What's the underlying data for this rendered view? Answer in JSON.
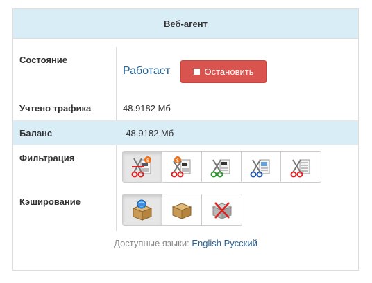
{
  "panel": {
    "title": "Веб-агент"
  },
  "status": {
    "label": "Состояние",
    "value": "Работает",
    "stop_label": "Остановить"
  },
  "traffic": {
    "label": "Учтено трафика",
    "value": "48.9182 Мб"
  },
  "balance": {
    "label": "Баланс",
    "value": "-48.9182 Мб"
  },
  "filtering": {
    "label": "Фильтрация",
    "buttons": [
      {
        "icon": "scissors-dollar-media-icon",
        "active": true
      },
      {
        "icon": "scissors-dollar-video-icon",
        "active": false
      },
      {
        "icon": "scissors-video-list-icon",
        "active": false
      },
      {
        "icon": "scissors-image-list-icon",
        "active": false
      },
      {
        "icon": "scissors-list-icon",
        "active": false
      }
    ]
  },
  "caching": {
    "label": "Кэширование",
    "buttons": [
      {
        "icon": "box-globe-icon",
        "active": true
      },
      {
        "icon": "box-icon",
        "active": false
      },
      {
        "icon": "box-disabled-icon",
        "active": false
      }
    ]
  },
  "languages": {
    "label": "Доступные языки:",
    "items": [
      "English",
      "Русский"
    ]
  }
}
